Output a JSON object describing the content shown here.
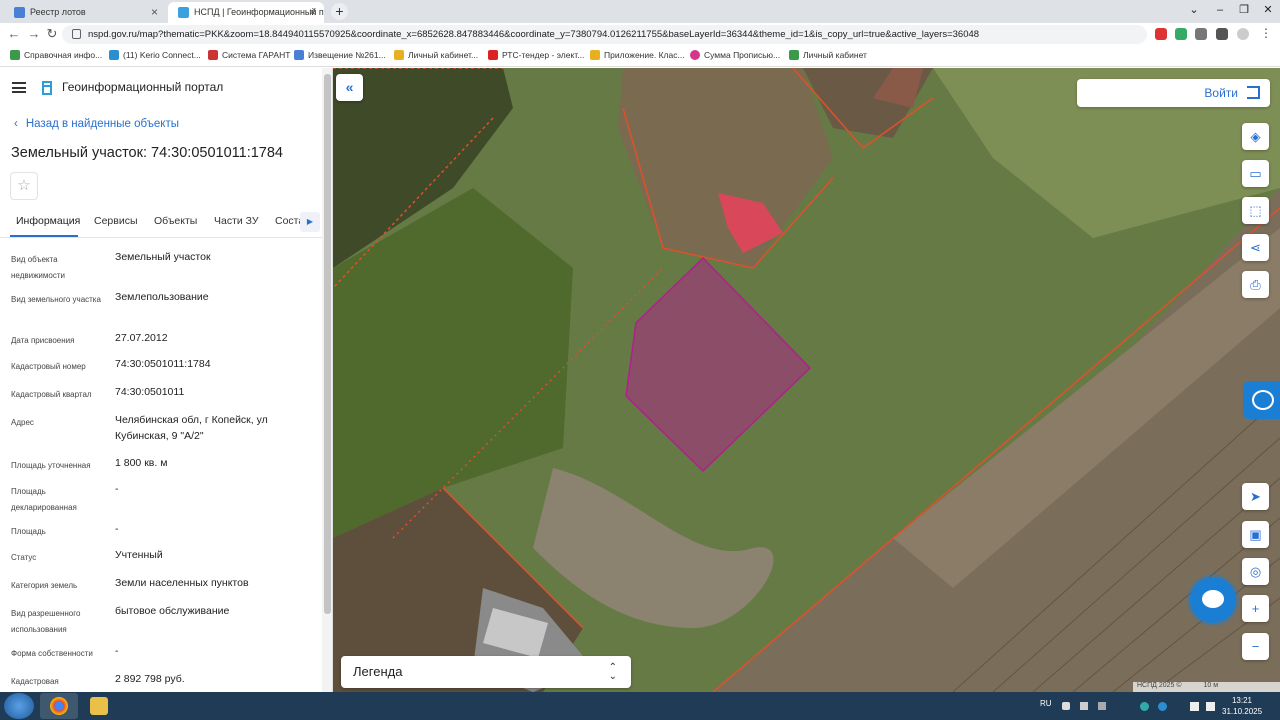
{
  "browser": {
    "tabs": [
      {
        "title": "Реестр лотов",
        "active": false
      },
      {
        "title": "НСПД | Геоинформационный п...",
        "active": true
      }
    ],
    "new_tab": "+",
    "url": "nspd.gov.ru/map?thematic=PKK&zoom=18.844940115570925&coordinate_x=6852628.847883446&coordinate_y=7380794.0126211755&baseLayerId=36344&theme_id=1&is_copy_url=true&active_layers=36048",
    "bookmarks": [
      "Справочная инфо...",
      "(11) Kerio Connect...",
      "Система ГАРАНТ",
      "Извещение №261...",
      "Личный кабинет...",
      "РТС-тендер - элект...",
      "Приложение. Клас...",
      "Сумма Прописью...",
      "Личный кабинет"
    ]
  },
  "header": {
    "portal_title": "Геоинформационный портал",
    "back_link": "Назад в найденные объекты",
    "object_title": "Земельный участок: 74:30:0501011:1784"
  },
  "tabs": [
    "Информация",
    "Сервисы",
    "Объекты",
    "Части ЗУ",
    "Соста"
  ],
  "info": [
    {
      "label": "Вид объекта недвижимости",
      "value": "Земельный участок"
    },
    {
      "label": "Вид земельного участка",
      "value": "Землепользование"
    },
    {
      "label": "Дата присвоения",
      "value": "27.07.2012"
    },
    {
      "label": "Кадастровый номер",
      "value": "74:30:0501011:1784"
    },
    {
      "label": "Кадастровый квартал",
      "value": "74:30:0501011"
    },
    {
      "label": "Адрес",
      "value": "Челябинская обл, г Копейск, ул Кубинская, 9 \"А/2\""
    },
    {
      "label": "Площадь уточненная",
      "value": "1 800 кв. м"
    },
    {
      "label": "Площадь декларированная",
      "value": "-"
    },
    {
      "label": "Площадь",
      "value": "-"
    },
    {
      "label": "Статус",
      "value": "Учтенный"
    },
    {
      "label": "Категория земель",
      "value": "Земли населенных пунктов"
    },
    {
      "label": "Вид разрешенного использования",
      "value": "бытовое обслуживание"
    },
    {
      "label": "Форма собственности",
      "value": "-"
    },
    {
      "label": "Кадастровая",
      "value": "2 892 798 руб."
    }
  ],
  "map": {
    "login_label": "Войти",
    "legend_label": "Легенда",
    "attribution": "НСПД 2025 ©",
    "scale": "10 м",
    "parcel_color": "#b0208c",
    "boundary_color": "#e0502a"
  },
  "taskbar": {
    "lang": "RU",
    "time": "13:21",
    "date": "31.10.2025"
  }
}
